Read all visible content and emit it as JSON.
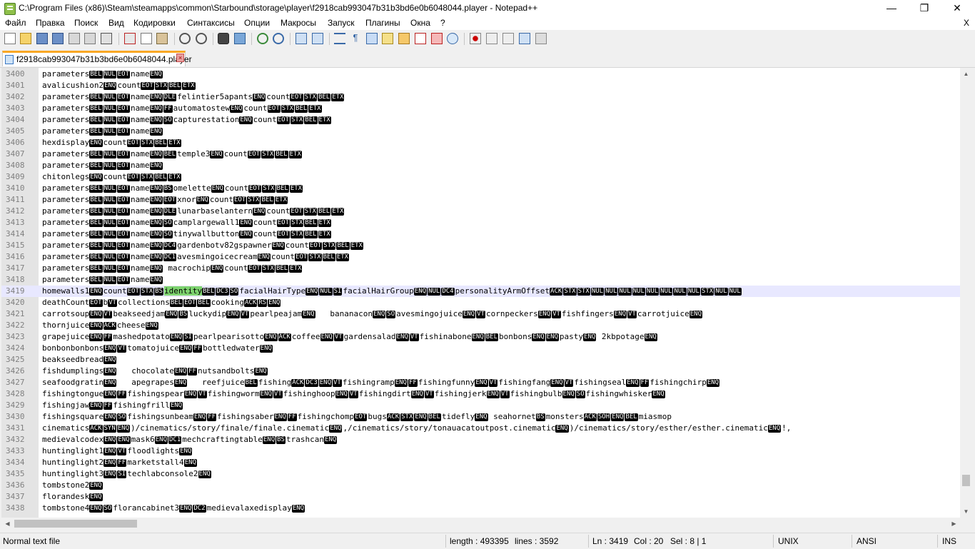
{
  "window": {
    "title": "C:\\Program Files (x86)\\Steam\\steamapps\\common\\Starbound\\storage\\player\\f2918cab993047b31b3bd6e0b6048044.player - Notepad++",
    "minimize": "—",
    "maximize": "❐",
    "close": "✕"
  },
  "menu": [
    "Файл",
    "Правка",
    "Поиск",
    "Вид",
    "Кодировки",
    "Синтаксисы",
    "Опции",
    "Макросы",
    "Запуск",
    "Плагины",
    "Окна",
    "?"
  ],
  "menu_close": "X",
  "tab": {
    "label": "f2918cab993047b31b3bd6e0b6048044.player",
    "close": "×"
  },
  "lines": [
    {
      "n": "3400",
      "t": "parameters⟦BEL⟧⟦NUL⟧⟦EOT⟧name⟦ENQ⟧"
    },
    {
      "n": "3401",
      "t": "avalicushion2⟦ENQ⟧count⟦EOT⟧⟦STX⟧⟦BEL⟧⟦ETX⟧"
    },
    {
      "n": "3402",
      "t": "parameters⟦BEL⟧⟦NUL⟧⟦EOT⟧name⟦ENQ⟧⟦DLE⟧felintier5apants⟦ENQ⟧count⟦EOT⟧⟦STX⟧⟦BEL⟧⟦ETX⟧"
    },
    {
      "n": "3403",
      "t": "parameters⟦BEL⟧⟦NUL⟧⟦EOT⟧name⟦ENQ⟧⟦FF⟧automatostew⟦ENQ⟧count⟦EOT⟧⟦STX⟧⟦BEL⟧⟦ETX⟧"
    },
    {
      "n": "3404",
      "t": "parameters⟦BEL⟧⟦NUL⟧⟦EOT⟧name⟦ENQ⟧⟦SO⟧capturestation⟦ENQ⟧count⟦EOT⟧⟦STX⟧⟦BEL⟧⟦ETX⟧"
    },
    {
      "n": "3405",
      "t": "parameters⟦BEL⟧⟦NUL⟧⟦EOT⟧name⟦ENQ⟧"
    },
    {
      "n": "3406",
      "t": "hexdisplay⟦ENQ⟧count⟦EOT⟧⟦STX⟧⟦BEL⟧⟦ETX⟧"
    },
    {
      "n": "3407",
      "t": "parameters⟦BEL⟧⟦NUL⟧⟦EOT⟧name⟦ENQ⟧⟦BEL⟧temple3⟦ENQ⟧count⟦EOT⟧⟦STX⟧⟦BEL⟧⟦ETX⟧"
    },
    {
      "n": "3408",
      "t": "parameters⟦BEL⟧⟦NUL⟧⟦EOT⟧name⟦ENQ⟧"
    },
    {
      "n": "3409",
      "t": "chitonlegs⟦ENQ⟧count⟦EOT⟧⟦STX⟧⟦BEL⟧⟦ETX⟧"
    },
    {
      "n": "3410",
      "t": "parameters⟦BEL⟧⟦NUL⟧⟦EOT⟧name⟦ENQ⟧⟦BS⟧omelette⟦ENQ⟧count⟦EOT⟧⟦STX⟧⟦BEL⟧⟦ETX⟧"
    },
    {
      "n": "3411",
      "t": "parameters⟦BEL⟧⟦NUL⟧⟦EOT⟧name⟦ENQ⟧⟦EOT⟧xnor⟦ENQ⟧count⟦EOT⟧⟦STX⟧⟦BEL⟧⟦ETX⟧"
    },
    {
      "n": "3412",
      "t": "parameters⟦BEL⟧⟦NUL⟧⟦EOT⟧name⟦ENQ⟧⟦DLE⟧lunarbaselantern⟦ENQ⟧count⟦EOT⟧⟦STX⟧⟦BEL⟧⟦ETX⟧"
    },
    {
      "n": "3413",
      "t": "parameters⟦BEL⟧⟦NUL⟧⟦EOT⟧name⟦ENQ⟧⟦SO⟧camplargewall1⟦ENQ⟧count⟦EOT⟧⟦STX⟧⟦BEL⟧⟦ETX⟧"
    },
    {
      "n": "3414",
      "t": "parameters⟦BEL⟧⟦NUL⟧⟦EOT⟧name⟦ENQ⟧⟦SO⟧tinywallbutton⟦ENQ⟧count⟦EOT⟧⟦STX⟧⟦BEL⟧⟦ETX⟧"
    },
    {
      "n": "3415",
      "t": "parameters⟦BEL⟧⟦NUL⟧⟦EOT⟧name⟦ENQ⟧⟦DC4⟧gardenbotv82gspawner⟦ENQ⟧count⟦EOT⟧⟦STX⟧⟦BEL⟧⟦ETX⟧"
    },
    {
      "n": "3416",
      "t": "parameters⟦BEL⟧⟦NUL⟧⟦EOT⟧name⟦ENQ⟧⟦DC1⟧avesmingoicecream⟦ENQ⟧count⟦EOT⟧⟦STX⟧⟦BEL⟧⟦ETX⟧"
    },
    {
      "n": "3417",
      "t": "parameters⟦BEL⟧⟦NUL⟧⟦EOT⟧name⟦ENQ⟧ macrochip⟦ENQ⟧count⟦EOT⟧⟦STX⟧⟦BEL⟧⟦ETX⟧"
    },
    {
      "n": "3418",
      "t": "parameters⟦BEL⟧⟦NUL⟧⟦EOT⟧name⟦ENQ⟧"
    },
    {
      "n": "3419",
      "t": "homewalls1⟦ENQ⟧count⟦EOT⟧⟦STX⟧⟦BS⟧‹identity›⟦BEL⟧⟦DC3⟧⟦SO⟧facialHairType⟦ENQ⟧⟦NUL⟧⟦SI⟧facialHairGroup⟦ENQ⟧⟦NUL⟧⟦DC4⟧personalityArmOffset⟦ACK⟧⟦STX⟧⟦STX⟧⟦NUL⟧⟦NUL⟧⟦NUL⟧⟦NUL⟧⟦NUL⟧⟦NUL⟧⟦NUL⟧⟦NUL⟧⟦STX⟧⟦NUL⟧⟦NUL⟧",
      "current": true
    },
    {
      "n": "3420",
      "t": "deathCount⟦EOT⟧b⟦VT⟧collections⟦BEL⟧⟦EOT⟧⟦BEL⟧cooking⟦ACK⟧⟦RS⟧⟦ENQ⟧"
    },
    {
      "n": "3421",
      "t": "carrotsoup⟦ENQ⟧⟦VT⟧beakseedjam⟦ENQ⟧⟦BS⟧luckydip⟦ENQ⟧⟦VT⟧pearlpeajam⟦ENQ⟧   bananacon⟦ENQ⟧⟦SO⟧avesmingojuice⟦ENQ⟧⟦VT⟧cornpeckers⟦ENQ⟧⟦VT⟧fishfingers⟦ENQ⟧⟦VT⟧carrotjuice⟦ENQ⟧"
    },
    {
      "n": "3422",
      "t": "thornjuice⟦ENQ⟧⟦ACK⟧cheese⟦ENQ⟧"
    },
    {
      "n": "3423",
      "t": "grapejuice⟦ENQ⟧⟦FF⟧mashedpotato⟦ENQ⟧⟦SI⟧pearlpearisotto⟦ENQ⟧⟦ACK⟧coffee⟦ENQ⟧⟦VT⟧gardensalad⟦ENQ⟧⟦VT⟧fishinabone⟦ENQ⟧⟦BEL⟧bonbons⟦ENQ⟧⟦ENQ⟧pasty⟦ENQ⟧ 2kbpotage⟦ENQ⟧"
    },
    {
      "n": "3424",
      "t": "bonbonbonbons⟦ENQ⟧⟦VT⟧tomatojuice⟦ENQ⟧⟦FF⟧bottledwater⟦ENQ⟧"
    },
    {
      "n": "3425",
      "t": "beakseedbread⟦ENQ⟧"
    },
    {
      "n": "3426",
      "t": "fishdumplings⟦ENQ⟧   chocolate⟦ENQ⟧⟦FF⟧nutsandbolts⟦ENQ⟧"
    },
    {
      "n": "3427",
      "t": "seafoodgratin⟦ENQ⟧   apegrapes⟦ENQ⟧   reefjuice⟦BEL⟧fishing⟦ACK⟧⟦DC3⟧⟦ENQ⟧⟦VT⟧fishingramp⟦ENQ⟧⟦FF⟧fishingfunny⟦ENQ⟧⟦VT⟧fishingfang⟦ENQ⟧⟦VT⟧fishingseal⟦ENQ⟧⟦FF⟧fishingchirp⟦ENQ⟧"
    },
    {
      "n": "3428",
      "t": "fishingtongue⟦ENQ⟧⟦FF⟧fishingspear⟦ENQ⟧⟦VT⟧fishingworm⟦ENQ⟧⟦VT⟧fishinghoop⟦ENQ⟧⟦VT⟧fishingdirt⟦ENQ⟧⟦VT⟧fishingjerk⟦ENQ⟧⟦VT⟧fishingbulb⟦ENQ⟧⟦SO⟧fishingwhisker⟦ENQ⟧"
    },
    {
      "n": "3429",
      "t": "fishingjaw⟦ENQ⟧⟦FF⟧fishingfrill⟦ENQ⟧"
    },
    {
      "n": "3430",
      "t": "fishingsquare⟦ENQ⟧⟦SO⟧fishingsunbeam⟦ENQ⟧⟦FF⟧fishingsaber⟦ENQ⟧⟦FF⟧fishingchomp⟦EOT⟧bugs⟦ACK⟧⟦STX⟧⟦ENQ⟧⟦BEL⟧tidefly⟦ENQ⟧ seahornet⟦BS⟧monsters⟦ACK⟧⟦SOH⟧⟦ENQ⟧⟦BEL⟧miasmop"
    },
    {
      "n": "3431",
      "t": "cinematics⟦ACK⟧⟦SYN⟧⟦ENQ⟧)/cinematics/story/finale/finale.cinematic⟦ENQ⟧,/cinematics/story/tonauacatoutpost.cinematic⟦ENQ⟧)/cinematics/story/esther/esther.cinematic⟦ENQ⟧!,"
    },
    {
      "n": "3432",
      "t": "medievalcodex⟦ENQ⟧⟦ENQ⟧mask6⟦ENQ⟧⟦DC1⟧mechcraftingtable⟦ENQ⟧⟦BS⟧trashcan⟦ENQ⟧"
    },
    {
      "n": "3433",
      "t": "huntinglight1⟦ENQ⟧⟦VT⟧floodlights⟦ENQ⟧"
    },
    {
      "n": "3434",
      "t": "huntinglight2⟦ENQ⟧⟦FF⟧marketstall4⟦ENQ⟧"
    },
    {
      "n": "3435",
      "t": "huntinglight3⟦ENQ⟧⟦SI⟧techlabconsole2⟦ENQ⟧"
    },
    {
      "n": "3436",
      "t": "tombstone2⟦ENQ⟧"
    },
    {
      "n": "3437",
      "t": "florandesk⟦ENQ⟧"
    },
    {
      "n": "3438",
      "t": "tombstone4⟦ENQ⟧⟦SO⟧florancabinet3⟦ENQ⟧⟦DC2⟧medievalaxedisplay⟦ENQ⟧"
    }
  ],
  "status": {
    "file_type": "Normal text file",
    "length": "length : 493395",
    "lines": "lines : 3592",
    "ln": "Ln : 3419",
    "col": "Col : 20",
    "sel": "Sel : 8 | 1",
    "eol": "UNIX",
    "encoding": "ANSI",
    "mode": "INS"
  },
  "colors": {
    "selection_highlight": "#7ed36e",
    "current_line": "#e8e8ff",
    "tab_accent": "#f9a825"
  }
}
